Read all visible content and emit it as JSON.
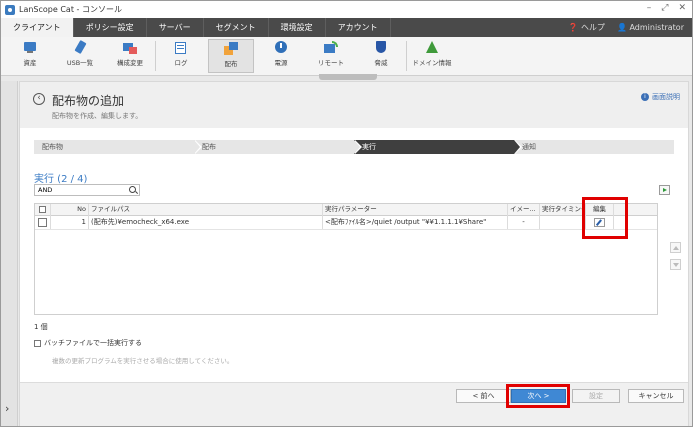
{
  "window": {
    "title": "LanScope Cat - コンソール"
  },
  "tabs": [
    {
      "label": "クライアント",
      "active": true
    },
    {
      "label": "ポリシー設定",
      "active": false
    },
    {
      "label": "サーバー",
      "active": false
    },
    {
      "label": "セグメント",
      "active": false
    },
    {
      "label": "環境設定",
      "active": false
    },
    {
      "label": "アカウント",
      "active": false
    }
  ],
  "header_right": {
    "help": "ヘルプ",
    "user": "Administrator"
  },
  "toolbar": [
    {
      "label": "資産",
      "icon": "asset-icon"
    },
    {
      "label": "USB一覧",
      "icon": "usb-icon"
    },
    {
      "label": "構成変更",
      "icon": "config-change-icon"
    },
    {
      "label": "ログ",
      "icon": "log-icon"
    },
    {
      "label": "配布",
      "icon": "distribute-icon",
      "active": true
    },
    {
      "label": "電源",
      "icon": "power-icon"
    },
    {
      "label": "リモート",
      "icon": "remote-icon"
    },
    {
      "label": "脅威",
      "icon": "shield-icon"
    },
    {
      "label": "ドメイン情報",
      "icon": "domain-icon"
    }
  ],
  "page": {
    "title": "配布物の追加",
    "subtitle": "配布物を作成、編集します。",
    "help_link": "画面説明"
  },
  "steps": [
    "配布物",
    "配布",
    "実行",
    "通知"
  ],
  "active_step": 2,
  "section": {
    "title": "実行 (2 / 4)"
  },
  "search": {
    "value": "AND",
    "placeholder": ""
  },
  "grid": {
    "columns": [
      "No",
      "ファイルパス",
      "実行パラメーター",
      "イメー...",
      "実行タイミング",
      "編集"
    ],
    "rows": [
      {
        "no": "1",
        "path": "(配布先)¥emocheck_x64.exe",
        "params": "<配布ﾌｧｲﾙ名>/quiet /output \"¥¥1.1.1.1¥Share\"",
        "image": "-",
        "timing": ""
      }
    ]
  },
  "count": "1 個",
  "batch": {
    "label": "バッチファイルで一括実行する",
    "note": "複数の更新プログラムを実行させる場合に使用してください。"
  },
  "footer": {
    "prev": "< 前へ",
    "next": "次へ >",
    "settings": "設定",
    "cancel": "キャンセル"
  },
  "colors": {
    "accent": "#3f88d4",
    "highlight": "#e00000",
    "tabbar": "#4a4a4a"
  }
}
